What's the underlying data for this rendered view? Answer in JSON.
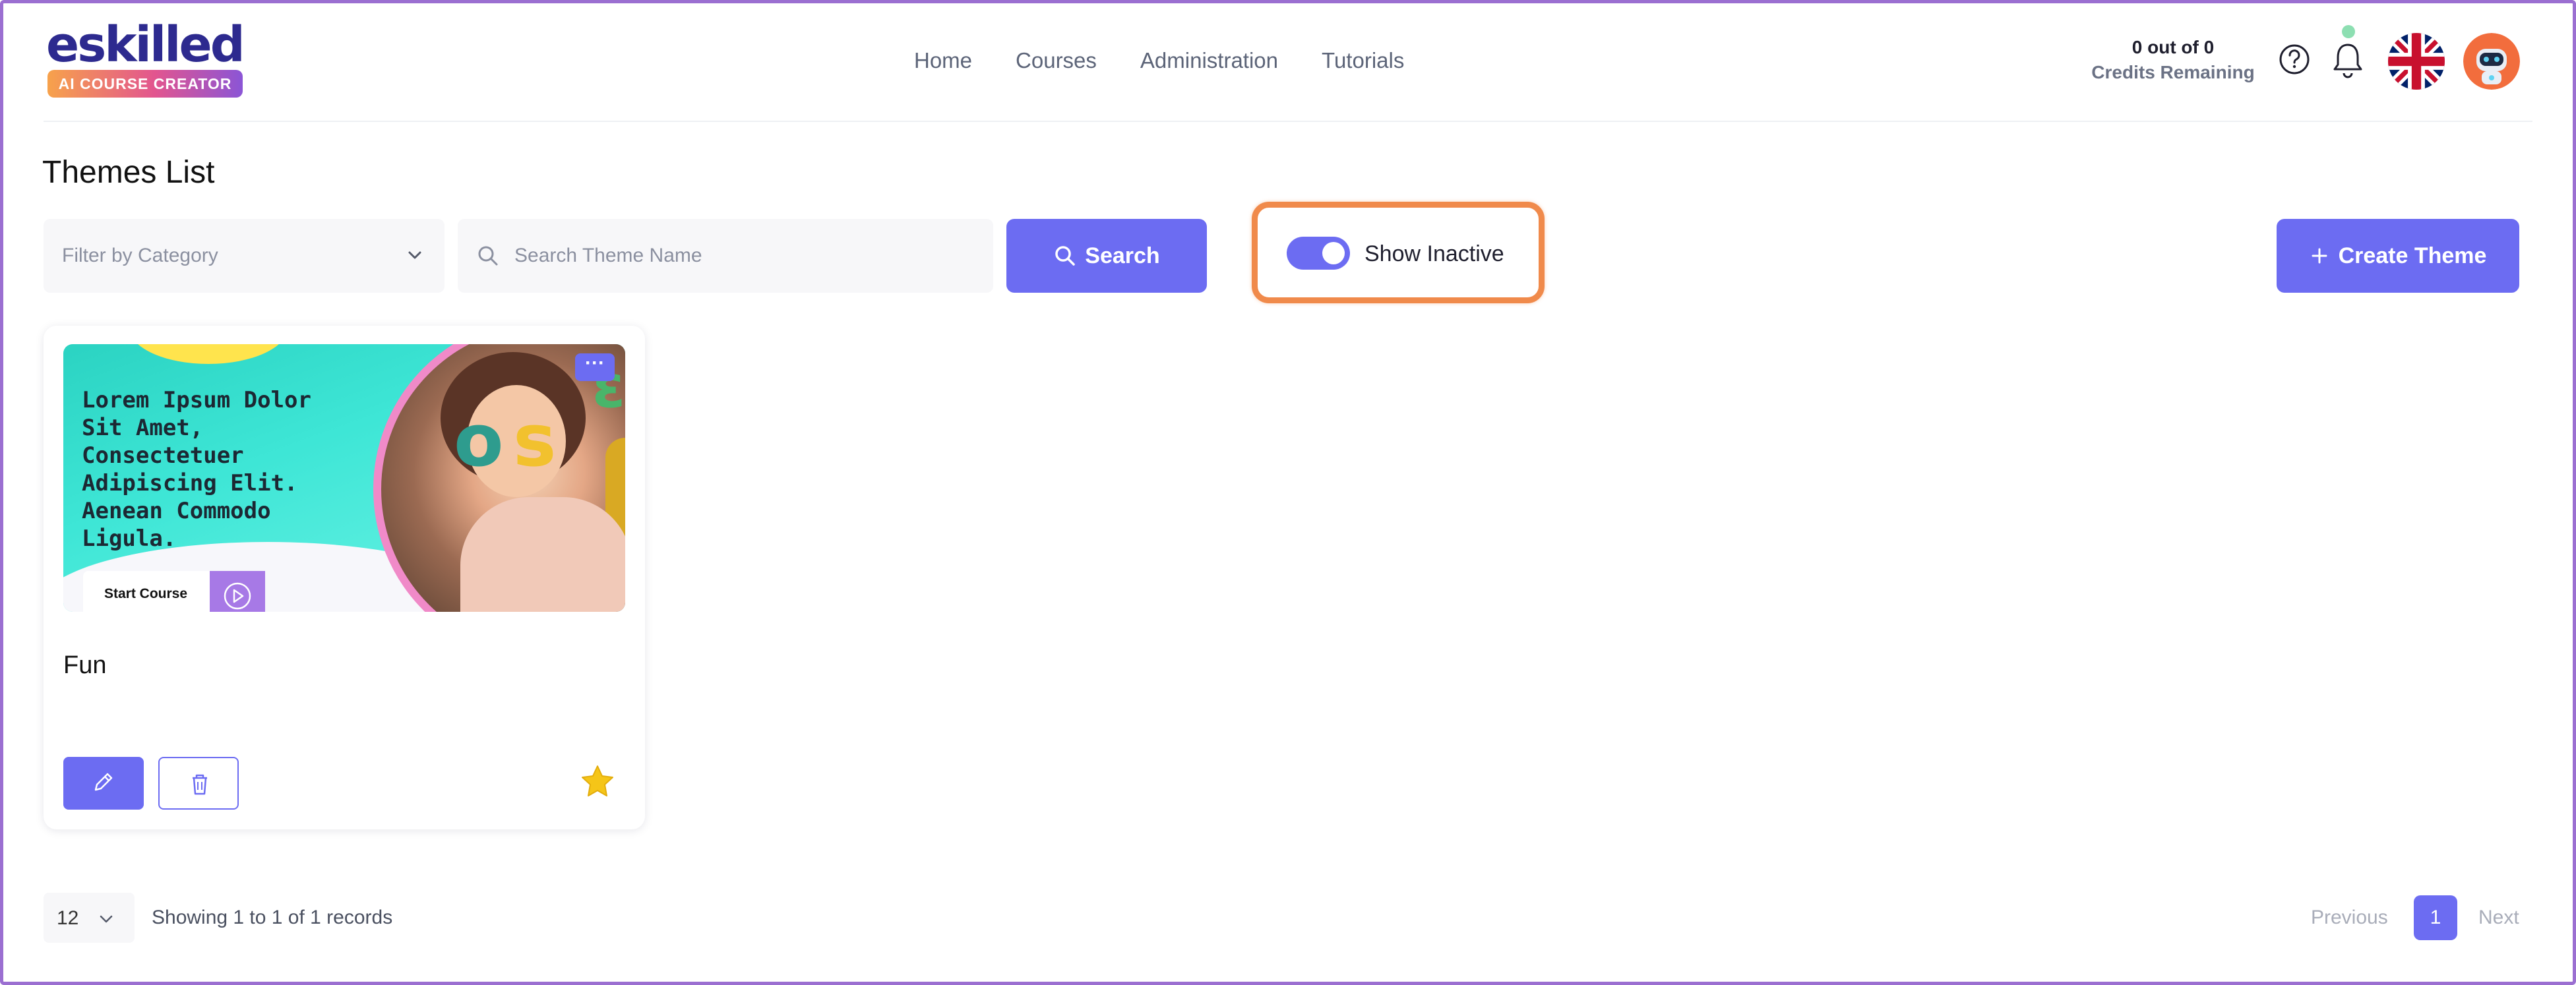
{
  "brand": {
    "name": "eskilled",
    "tagline": "AI COURSE CREATOR"
  },
  "nav": {
    "items": [
      "Home",
      "Courses",
      "Administration",
      "Tutorials"
    ]
  },
  "credits": {
    "line1": "0 out of 0",
    "line2": "Credits Remaining"
  },
  "header_icons": [
    "help-icon",
    "bell-icon",
    "uk-flag-icon",
    "robot-avatar"
  ],
  "page": {
    "title": "Themes List"
  },
  "filters": {
    "category_placeholder": "Filter by Category",
    "search_placeholder": "Search Theme Name",
    "search_button": "Search",
    "toggle_label": "Show Inactive",
    "toggle_on": true,
    "create_button": "Create Theme"
  },
  "themes": [
    {
      "name": "Fun",
      "preview_text": "Lorem Ipsum Dolor Sit Amet, Consectetuer Adipiscing Elit. Aenean Commodo Ligula.",
      "preview_button": "Start Course",
      "favorite": true
    }
  ],
  "pagination": {
    "per_page": "12",
    "records_text": "Showing 1 to 1 of 1 records",
    "previous": "Previous",
    "current_page": "1",
    "next": "Next"
  },
  "colors": {
    "accent": "#6c6cf2",
    "highlight": "#f08a4b",
    "brand_dark": "#2d2a8f",
    "star": "#f5c518"
  }
}
